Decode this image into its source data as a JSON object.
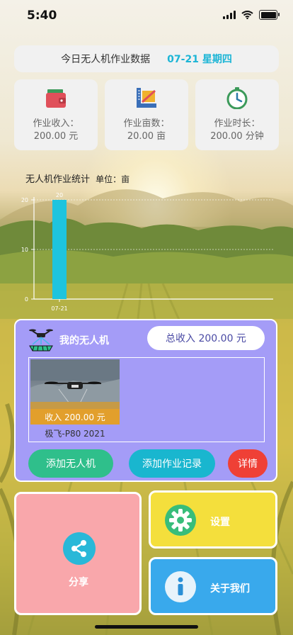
{
  "status_bar": {
    "time": "5:40"
  },
  "header": {
    "title": "今日无人机作业数据",
    "date": "07-21 星期四"
  },
  "stats": [
    {
      "label": "作业收入：",
      "value": "200.00 元",
      "icon": "wallet-icon"
    },
    {
      "label": "作业亩数：",
      "value": "20.00 亩",
      "icon": "ruler-icon"
    },
    {
      "label": "作业时长：",
      "value": "200.00 分钟",
      "icon": "stopwatch-icon"
    }
  ],
  "chart_title": {
    "title": "无人机作业统计",
    "unit": "单位：亩"
  },
  "chart_data": {
    "type": "bar",
    "categories": [
      "07-21"
    ],
    "values": [
      20
    ],
    "data_labels": [
      "20"
    ],
    "y_ticks": [
      "0",
      "10",
      "20"
    ],
    "ylim": [
      0,
      20
    ],
    "bar_color": "#1ec4de"
  },
  "drone_panel": {
    "title": "我的无人机",
    "total_income": "总收入 200.00 元",
    "drones": [
      {
        "income": "收入 200.00 元",
        "name": "极飞-P80 2021"
      }
    ],
    "buttons": {
      "add_drone": "添加无人机",
      "add_record": "添加作业记录",
      "details": "详情"
    }
  },
  "tiles": {
    "share": "分享",
    "settings": "设置",
    "about": "关于我们"
  },
  "colors": {
    "accent": "#1cb5d6",
    "panel": "#a49cf7",
    "green": "#2fbf8b",
    "cyan": "#19b6cf",
    "red": "#ef4036",
    "share_tile": "#f9a7ab",
    "settings_tile": "#f4df3c",
    "about_tile": "#39a9ec"
  }
}
